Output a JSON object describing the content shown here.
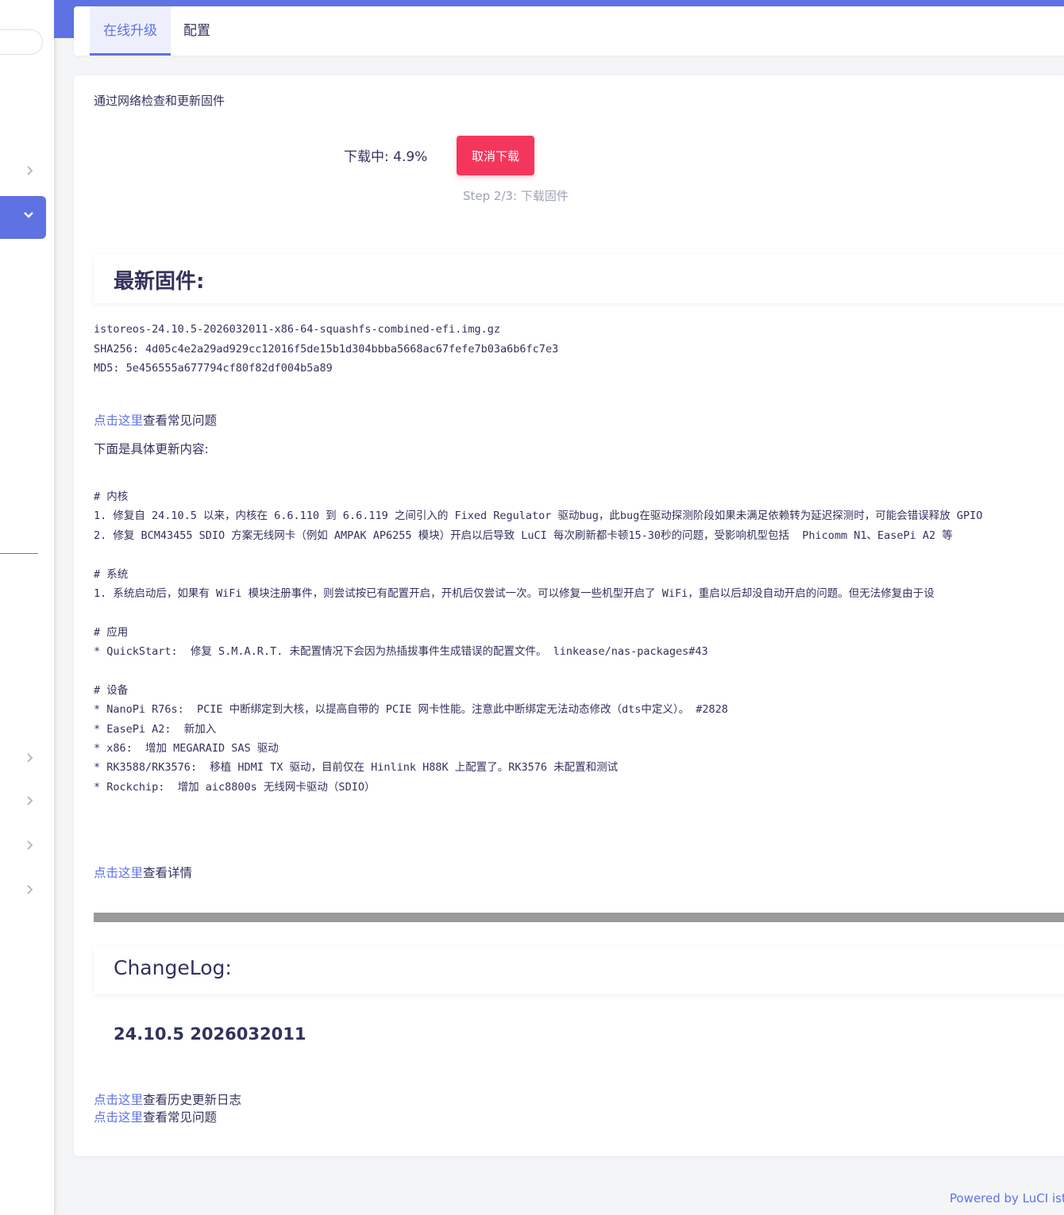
{
  "tabs": [
    {
      "label": "在线升级",
      "active": true
    },
    {
      "label": "配置",
      "active": false
    }
  ],
  "description": "通过网络检查和更新固件",
  "download": {
    "status_label": "下载中: ",
    "progress_percent": "4.9%",
    "cancel_button": "取消下载",
    "step": "Step 2/3: 下载固件"
  },
  "latest": {
    "heading": "最新固件:",
    "filename": "istoreos-24.10.5-2026032011-x86-64-squashfs-combined-efi.img.gz",
    "sha256": "SHA256: 4d05c4e2a29ad929cc12016f5de15b1d304bbba5668ac67fefe7b03a6b6fc7e3",
    "md5": "MD5: 5e456555a677794cf80f82df004b5a89"
  },
  "faq_link": {
    "link": "点击这里",
    "text": "查看常见问题"
  },
  "intro": "下面是具体更新内容:",
  "content_lines": [
    "# 内核",
    "1. 修复自 24.10.5 以来，内核在 6.6.110 到 6.6.119 之间引入的 Fixed Regulator 驱动bug，此bug在驱动探测阶段如果未满足依赖转为延迟探测时，可能会错误释放 GPIO",
    "2. 修复 BCM43455 SDIO 方案无线网卡（例如 AMPAK AP6255 模块）开启以后导致 LuCI 每次刷新都卡顿15-30秒的问题，受影响机型包括  Phicomm N1、EasePi A2 等",
    "",
    "# 系统",
    "1. 系统启动后，如果有 WiFi 模块注册事件，则尝试按已有配置开启，开机后仅尝试一次。可以修复一些机型开启了 WiFi，重启以后却没自动开启的问题。但无法修复由于设",
    "",
    "# 应用",
    "* QuickStart:  修复 S.M.A.R.T. 未配置情况下会因为热插拔事件生成错误的配置文件。 linkease/nas-packages#43",
    "",
    "# 设备",
    "* NanoPi R76s:  PCIE 中断绑定到大核，以提高自带的 PCIE 网卡性能。注意此中断绑定无法动态修改（dts中定义）。 #2828",
    "* EasePi A2:  新加入",
    "* x86:  增加 MEGARAID SAS 驱动",
    "* RK3588/RK3576:  移植 HDMI TX 驱动，目前仅在 Hinlink H88K 上配置了。RK3576 未配置和测试",
    "* Rockchip:  增加 aic8800s 无线网卡驱动（SDIO）"
  ],
  "details_link": {
    "link": "点击这里",
    "text": "查看详情"
  },
  "changelog": {
    "heading": "ChangeLog:",
    "version": "24.10.5 2026032011"
  },
  "history_link": {
    "link": "点击这里",
    "text": "查看历史更新日志"
  },
  "faq_link2": {
    "link": "点击这里",
    "text": "查看常见问题"
  },
  "footer": "Powered by LuCI istoreos",
  "colors": {
    "accent": "#5e72e4",
    "danger": "#f5365c",
    "muted": "#9ea3b3"
  },
  "icons": [
    "chevron-right-icon",
    "chevron-down-icon"
  ]
}
